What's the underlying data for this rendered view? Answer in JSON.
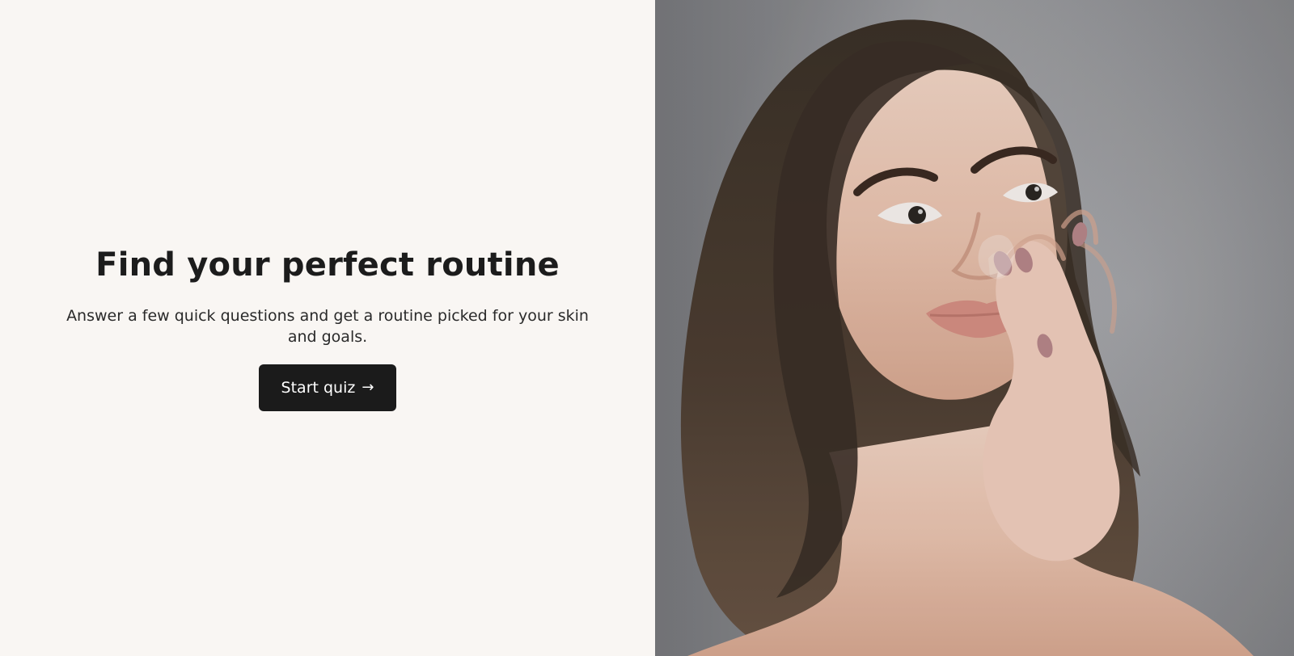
{
  "hero": {
    "title": "Find your perfect routine",
    "subtitle": "Answer a few quick questions and get a routine picked for your skin and goals.",
    "cta_label": "Start quiz",
    "cta_arrow": "→"
  },
  "colors": {
    "background": "#f9f6f3",
    "text": "#1c1c1c",
    "button_bg": "#1b1b1b",
    "button_text": "#ffffff"
  },
  "image": {
    "icon": "portrait-photo"
  }
}
